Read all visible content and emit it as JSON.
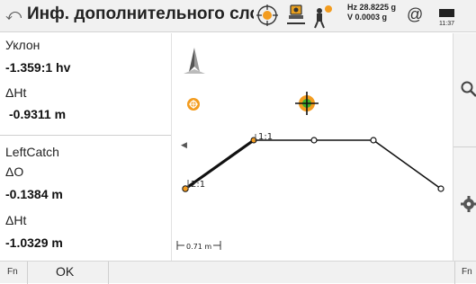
{
  "header": {
    "back_glyph": "⤺",
    "title": "Инф. дополнительного сло",
    "hz_line": "Hz 28.8225 g",
    "v_line": "V  0.0003 g",
    "at_symbol": "@",
    "time": "11:37",
    "icons": [
      "target-prism-icon",
      "instrument-icon",
      "person-alert-icon",
      "battery-icon"
    ]
  },
  "info": {
    "slope_label": "Уклон",
    "slope_value": "-1.359:1 hv",
    "dht1_label": "ΔHt",
    "dht1_value": "-0.9311 m",
    "catch_label": "LeftCatch",
    "do_label": "ΔO",
    "do_value": "-0.1384 m",
    "dht2_label": "ΔHt",
    "dht2_value": "-1.0329 m"
  },
  "plot": {
    "label_a": "1:1",
    "label_b": "2:1",
    "scale": "0.71 m",
    "collapse_glyph": "◀"
  },
  "right_toolbar": {
    "icons": [
      "search-icon",
      "settings-icon"
    ]
  },
  "bottom": {
    "fn_left": "Fn",
    "ok": "OK",
    "fn_right": "Fn"
  },
  "colors": {
    "accent_orange": "#f39c1f",
    "target_green": "#3fae2a",
    "line": "#111111"
  }
}
